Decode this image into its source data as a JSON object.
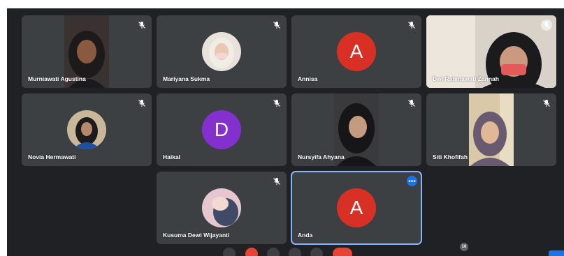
{
  "participants": [
    {
      "name": "Murniawati Agustina"
    },
    {
      "name": "Mariyana Sukma"
    },
    {
      "name": "Annisa",
      "initial": "A",
      "avatar_color": "#d93025"
    },
    {
      "name": "Dwi Rahmawati Zannah"
    },
    {
      "name": "Novia Hermawati"
    },
    {
      "name": "Haikal",
      "initial": "D",
      "avatar_color": "#8430ce"
    },
    {
      "name": "Nursyifa Ahyana"
    },
    {
      "name": "Siti Khofifah"
    },
    {
      "name": "Kusuma Dewi Wijayanti"
    },
    {
      "name": "Anda",
      "initial": "A",
      "avatar_color": "#d93025"
    }
  ],
  "participant_count": "10",
  "colors": {
    "stage_bg": "#202124",
    "tile_bg": "#3c4043",
    "active_border": "#8ab4f8",
    "accent": "#1a73e8",
    "end_call": "#ea4335"
  },
  "icons": {
    "muted": "mic-off-icon",
    "more": "more-options-icon"
  }
}
